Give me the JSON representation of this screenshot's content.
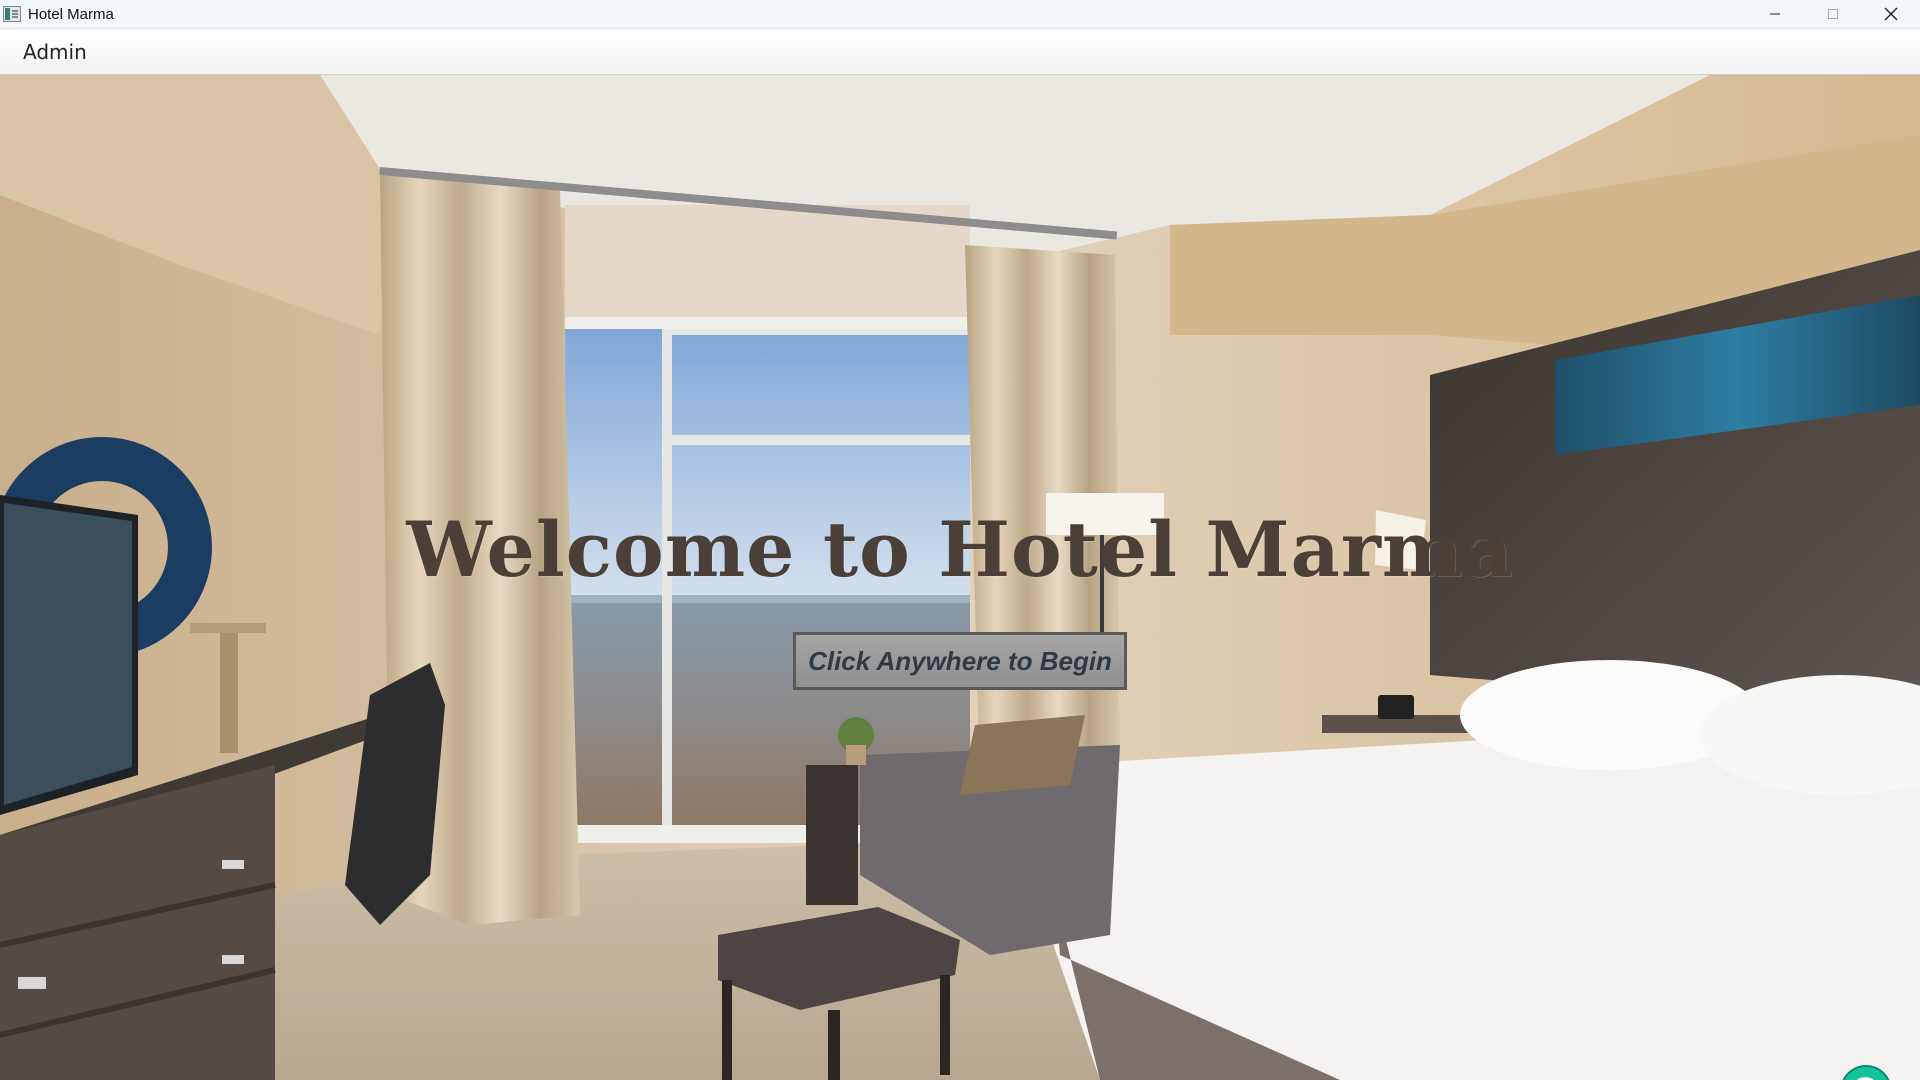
{
  "window": {
    "title": "Hotel Marma",
    "controls": [
      "minimize",
      "maximize",
      "close"
    ]
  },
  "menubar": {
    "items": [
      "Admin"
    ]
  },
  "main": {
    "welcome_text": "Welcome to Hotel Marma",
    "begin_button_label": "Click Anywhere to Begin",
    "background": "hotel room photograph"
  },
  "overlay": {
    "grammarly_icon": "grammarly-g-icon"
  },
  "colors": {
    "title_text": "#4a4038",
    "button_bg": "#9a9a9a",
    "button_text": "#2f3a44",
    "grammarly": "#15c39a"
  }
}
